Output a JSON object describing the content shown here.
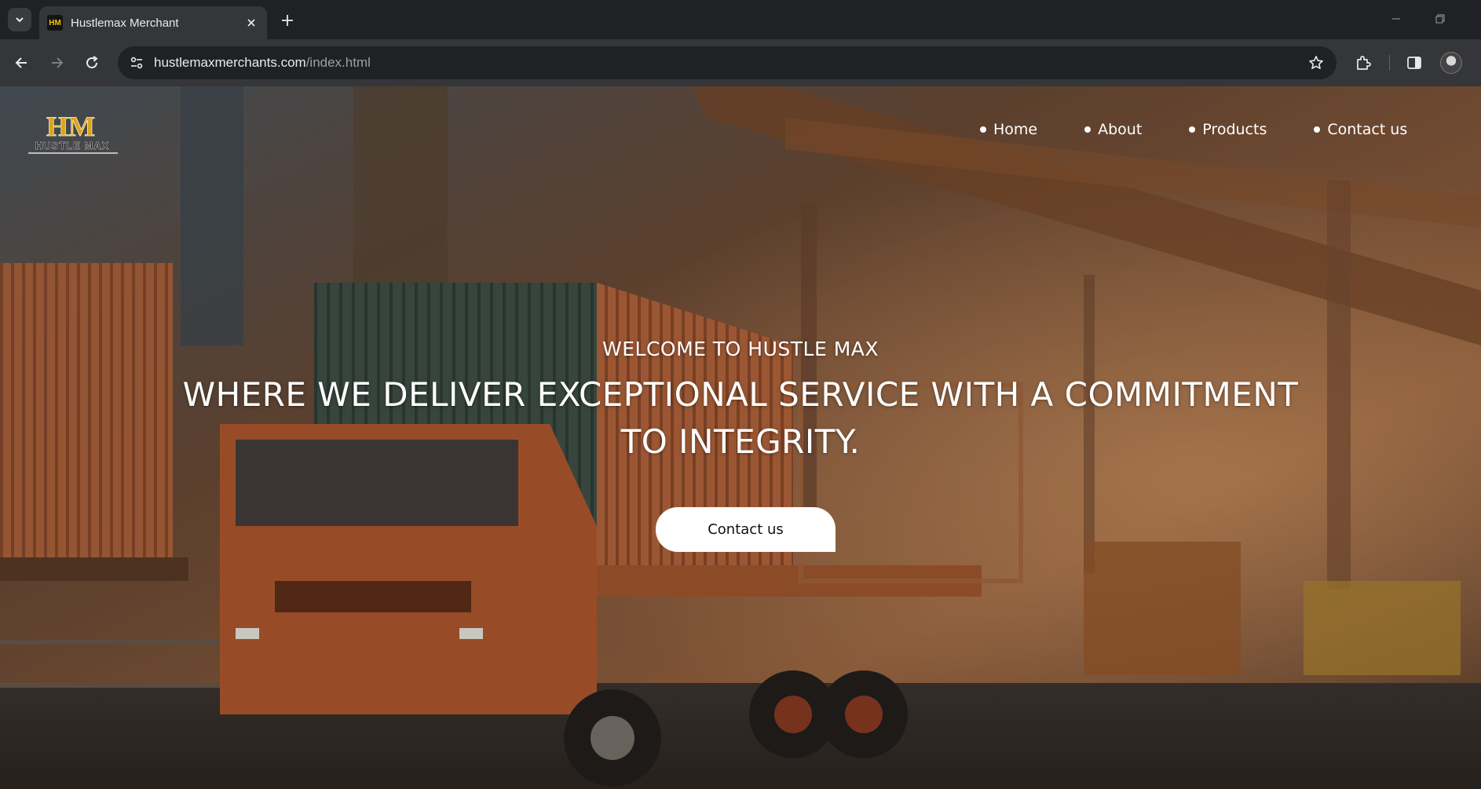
{
  "browser": {
    "tab": {
      "title": "Hustlemax Merchant",
      "favicon_text": "HM",
      "close_icon": "close-icon"
    },
    "url": {
      "host": "hustlemaxmerchants.com",
      "path": "/index.html"
    }
  },
  "site": {
    "logo": {
      "monogram": "HM",
      "name": "HUSTLE MAX"
    },
    "nav": [
      {
        "label": "Home"
      },
      {
        "label": "About"
      },
      {
        "label": "Products"
      },
      {
        "label": "Contact us"
      }
    ],
    "hero": {
      "kicker": "WELCOME TO HUSTLE MAX",
      "title": "WHERE WE DELIVER EXCEPTIONAL SERVICE WITH A COMMITMENT TO INTEGRITY.",
      "cta_label": "Contact us"
    }
  },
  "colors": {
    "chrome_dark": "#202124",
    "chrome_toolbar": "#35363a",
    "logo_gold": "#d9a420",
    "cta_bg": "#ffffff"
  }
}
